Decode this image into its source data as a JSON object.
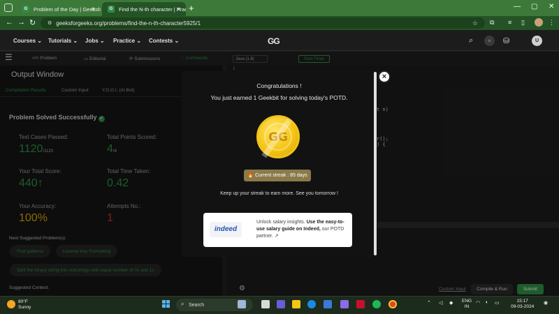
{
  "browser": {
    "tabs": [
      {
        "label": "Problem of the Day | GeeksforG"
      },
      {
        "label": "Find the N-th character | Practi"
      }
    ],
    "new_tab": "+",
    "url": "geeksforgeeks.org/problems/find-the-n-th-character5925/1"
  },
  "header": {
    "menu": [
      "Courses ⌄",
      "Tutorials ⌄",
      "Jobs ⌄",
      "Practice ⌄",
      "Contests ⌄"
    ],
    "logo_text": "GG",
    "avatar_letter": "U"
  },
  "problem_tabs": [
    "Problem",
    "Editorial",
    "Submissions",
    "Comments"
  ],
  "output": {
    "title": "Output Window",
    "subtabs": [
      "Compilation Results",
      "Custom Input",
      "Y.O.G.I. (AI Bot)"
    ],
    "status": "Problem Solved Successfully",
    "stats": {
      "test_cases_label": "Test Cases Passed:",
      "test_cases_value": "1120",
      "test_cases_total": "/1120",
      "points_label": "Total Points Scored:",
      "points_value": "4",
      "points_total": "/4",
      "score_label": "Your Total Score:",
      "score_value": "440↑",
      "time_label": "Total Time Taken:",
      "time_value": "0.42",
      "accuracy_label": "Your Accuracy:",
      "accuracy_value": "100%",
      "attempts_label": "Attempts No.:",
      "attempts_value": "1"
    },
    "next_suggested_label": "Next Suggested Problem(s):",
    "suggested": [
      "Find patterns",
      "License Key Formatting",
      "Split the binary string into substrings with equal number of 0s and 1s"
    ],
    "suggested_contest_label": "Suggested Contest:"
  },
  "editor": {
    "language": "Java (1.8)",
    "timer": "Start Timer",
    "line_number": "1",
    "fragments": [
      "t n)",
      "r();",
      ") {"
    ],
    "custom_input": "Custom Input",
    "compile": "Compile & Run",
    "submit": "Submit"
  },
  "modal": {
    "title": "Congratulations !",
    "subtitle": "You just earned 1 Geekbit for solving today's POTD.",
    "streak": "Current streak : 85 days",
    "keepup": "Keep up your streak to earn more. See you tomorrow !",
    "ad_logo": "indeed",
    "ad_text_prefix": "Unlock salary insights.",
    "ad_text_bold": "Use the easy-to-use salary guide on Indeed,",
    "ad_text_suffix": "our POTD partner.",
    "close": "×"
  },
  "taskbar": {
    "temperature": "80°F",
    "condition": "Sunny",
    "search": "Search",
    "lang1": "ENG",
    "lang2": "IN",
    "time": "15:17",
    "date": "09-03-2024"
  },
  "colors": {
    "accent": "#2f8d46",
    "tab_bar": "#3d7a3a",
    "address_bar": "#245425",
    "coin": "#f5c518",
    "indeed": "#2557a7"
  }
}
